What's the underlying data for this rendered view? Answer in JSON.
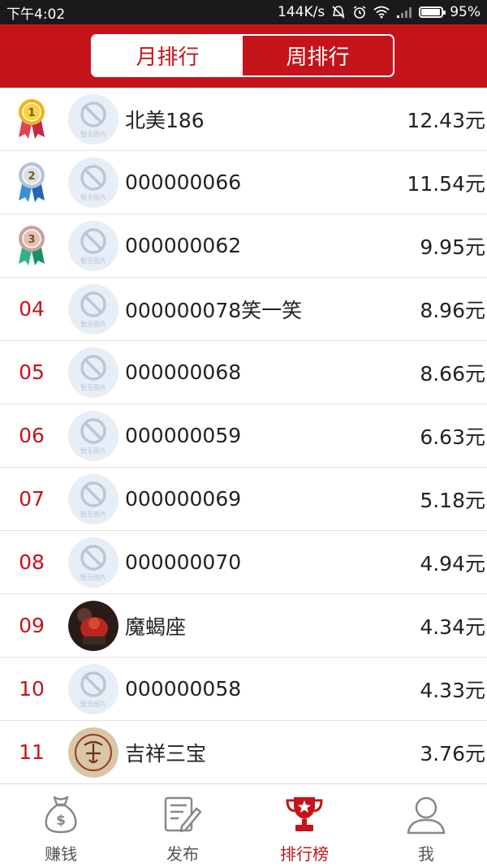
{
  "status_bar": {
    "time": "下午4:02",
    "network_speed": "144K/s",
    "battery_percent": "95%",
    "icons": [
      "alarm-off-icon",
      "alarm-icon",
      "wifi-icon",
      "signal-icon",
      "battery-icon"
    ]
  },
  "header": {
    "tabs": [
      {
        "label": "月排行",
        "active": false
      },
      {
        "label": "周排行",
        "active": true
      }
    ]
  },
  "ranking": {
    "no_image_text": "暂无图片",
    "rows": [
      {
        "rank": "1",
        "rank_style": "gold-medal",
        "avatar": "placeholder",
        "name": "北美186",
        "amount": "12.43元"
      },
      {
        "rank": "2",
        "rank_style": "silver-medal",
        "avatar": "placeholder",
        "name": "000000066",
        "amount": "11.54元"
      },
      {
        "rank": "3",
        "rank_style": "bronze-medal",
        "avatar": "placeholder",
        "name": "000000062",
        "amount": "9.95元"
      },
      {
        "rank": "04",
        "rank_style": "text",
        "avatar": "placeholder",
        "name": "000000078笑一笑",
        "amount": "8.96元"
      },
      {
        "rank": "05",
        "rank_style": "text",
        "avatar": "placeholder",
        "name": "000000068",
        "amount": "8.66元"
      },
      {
        "rank": "06",
        "rank_style": "text",
        "avatar": "placeholder",
        "name": "000000059",
        "amount": "6.63元"
      },
      {
        "rank": "07",
        "rank_style": "text",
        "avatar": "placeholder",
        "name": "000000069",
        "amount": "5.18元"
      },
      {
        "rank": "08",
        "rank_style": "text",
        "avatar": "placeholder",
        "name": "000000070",
        "amount": "4.94元"
      },
      {
        "rank": "09",
        "rank_style": "text",
        "avatar": "photo-red",
        "name": "魔蝎座",
        "amount": "4.34元"
      },
      {
        "rank": "10",
        "rank_style": "text",
        "avatar": "placeholder",
        "name": "000000058",
        "amount": "4.33元"
      },
      {
        "rank": "11",
        "rank_style": "text",
        "avatar": "photo-seal",
        "name": "吉祥三宝",
        "amount": "3.76元"
      }
    ]
  },
  "tab_bar": {
    "items": [
      {
        "label": "赚钱",
        "icon": "money-bag-icon",
        "active": false
      },
      {
        "label": "发布",
        "icon": "edit-note-icon",
        "active": false
      },
      {
        "label": "排行榜",
        "icon": "trophy-icon",
        "active": true
      },
      {
        "label": "我",
        "icon": "user-icon",
        "active": false
      }
    ]
  },
  "colors": {
    "brand_red": "#c4141a",
    "status_bar": "#1a1a1a",
    "divider": "#e3e3e3"
  }
}
